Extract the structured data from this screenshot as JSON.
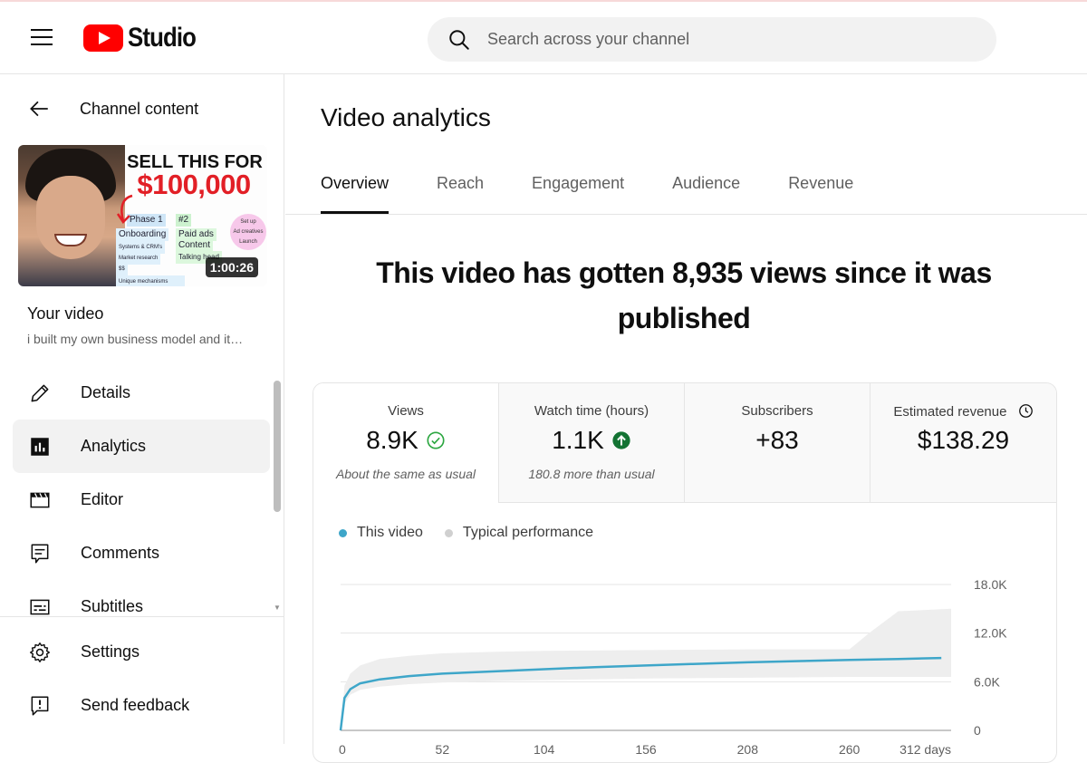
{
  "header": {
    "logo_text": "Studio",
    "search_placeholder": "Search across your channel"
  },
  "sidebar": {
    "back_label": "Channel content",
    "thumbnail": {
      "headline_line1": "SELL THIS FOR",
      "headline_line2": "$100,000",
      "phase_label": "Phase 1",
      "step2_label": "#2",
      "onboarding": "Onboarding",
      "paid_ads": "Paid ads",
      "content": "Content",
      "systems": "Systems & CRM's",
      "talking": "Talking head",
      "market_research": "Market research",
      "dollars": "$$",
      "unique": "Unique mechanisms",
      "setup": "Set up",
      "ad_creatives": "Ad creatives",
      "launch": "Launch",
      "duration": "1:00:26"
    },
    "your_video_label": "Your video",
    "video_title": "i built my own business model and it…",
    "nav_items": [
      {
        "label": "Details",
        "icon": "pencil-icon"
      },
      {
        "label": "Analytics",
        "icon": "analytics-icon"
      },
      {
        "label": "Editor",
        "icon": "clapperboard-icon"
      },
      {
        "label": "Comments",
        "icon": "comment-icon"
      },
      {
        "label": "Subtitles",
        "icon": "subtitles-icon"
      }
    ],
    "bottom_items": [
      {
        "label": "Settings",
        "icon": "gear-icon"
      },
      {
        "label": "Send feedback",
        "icon": "feedback-icon"
      }
    ]
  },
  "main": {
    "page_title": "Video analytics",
    "tabs": [
      {
        "label": "Overview"
      },
      {
        "label": "Reach"
      },
      {
        "label": "Engagement"
      },
      {
        "label": "Audience"
      },
      {
        "label": "Revenue"
      }
    ],
    "headline": "This video has gotten 8,935 views since it was published",
    "metrics": [
      {
        "label": "Views",
        "value": "8.9K",
        "note": "About the same as usual",
        "status_icon": "check-circle-icon"
      },
      {
        "label": "Watch time (hours)",
        "value": "1.1K",
        "note": "180.8 more than usual",
        "status_icon": "arrow-up-circle-icon"
      },
      {
        "label": "Subscribers",
        "value": "+83",
        "note": ""
      },
      {
        "label": "Estimated revenue",
        "value": "$138.29",
        "note": ""
      }
    ],
    "legend": {
      "this_video": "This video",
      "typical": "Typical performance"
    }
  },
  "colors": {
    "accent_red": "#ff0000",
    "series_blue": "#3ea6c9",
    "typical_band": "#eeeeee",
    "check_green": "#2ba640",
    "arrow_green": "#137333"
  },
  "chart_data": {
    "type": "line",
    "xlabel": "",
    "ylabel": "",
    "x_ticks": [
      "0",
      "52",
      "104",
      "156",
      "208",
      "260",
      "312 days"
    ],
    "y_ticks": [
      "0",
      "6.0K",
      "12.0K",
      "18.0K"
    ],
    "xlim": [
      0,
      312
    ],
    "ylim": [
      0,
      18000
    ],
    "grid": true,
    "legend_position": "top-left",
    "series": [
      {
        "name": "This video",
        "x": [
          0,
          2,
          5,
          10,
          20,
          35,
          52,
          80,
          104,
          130,
          156,
          180,
          208,
          235,
          260,
          285,
          307
        ],
        "values": [
          0,
          4000,
          5100,
          5800,
          6300,
          6700,
          7000,
          7300,
          7550,
          7800,
          8000,
          8200,
          8400,
          8550,
          8700,
          8800,
          8935
        ]
      },
      {
        "name": "Typical performance",
        "x": [
          0,
          2,
          5,
          10,
          20,
          35,
          52,
          80,
          104,
          156,
          208,
          260,
          270,
          285,
          312
        ],
        "low": [
          0,
          3300,
          4400,
          5000,
          5400,
          5700,
          5900,
          6100,
          6200,
          6400,
          6500,
          6600,
          6600,
          6600,
          6600
        ],
        "high": [
          0,
          5500,
          7000,
          8000,
          8800,
          9200,
          9500,
          9700,
          9800,
          9900,
          10000,
          10000,
          12000,
          14700,
          15000
        ]
      }
    ]
  }
}
